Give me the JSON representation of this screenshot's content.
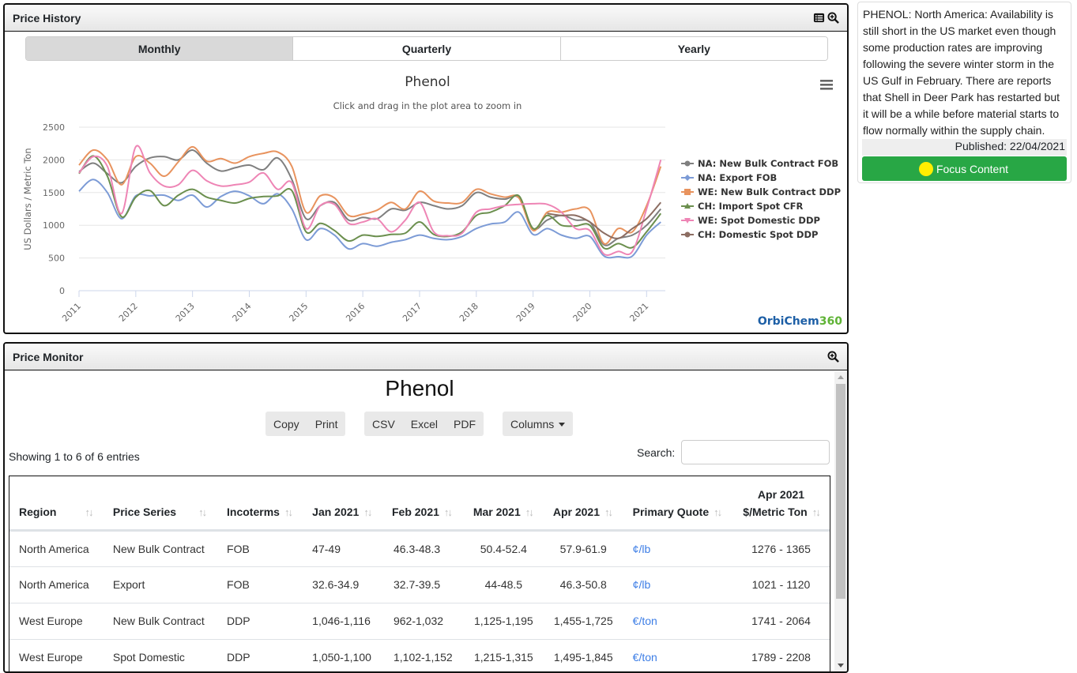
{
  "price_history": {
    "title": "Price History",
    "icons": [
      "table-icon",
      "zoom-in-icon"
    ],
    "tabs": [
      {
        "label": "Monthly",
        "active": true
      },
      {
        "label": "Quarterly",
        "active": false
      },
      {
        "label": "Yearly",
        "active": false
      }
    ],
    "menu_icon": "hamburger-menu-icon",
    "brand": {
      "main": "OrbiChem",
      "suffix": "360"
    }
  },
  "chart_data": {
    "type": "line",
    "title": "Phenol",
    "subtitle": "Click and drag in the plot area to zoom in",
    "xlabel": "",
    "ylabel": "US Dollars / Metric Ton",
    "ylim": [
      0,
      2500
    ],
    "yticks": [
      0,
      500,
      1000,
      1500,
      2000,
      2500
    ],
    "xlim": [
      2011.0,
      2021.33
    ],
    "xticks": [
      "2011",
      "2012",
      "2013",
      "2014",
      "2015",
      "2016",
      "2017",
      "2018",
      "2019",
      "2020",
      "2021"
    ],
    "grid": true,
    "legend_position": "right",
    "x": [
      2011.0,
      2011.25,
      2011.5,
      2011.75,
      2012.0,
      2012.25,
      2012.5,
      2012.75,
      2013.0,
      2013.25,
      2013.5,
      2013.75,
      2014.0,
      2014.25,
      2014.5,
      2014.75,
      2015.0,
      2015.25,
      2015.5,
      2015.75,
      2016.0,
      2016.25,
      2016.5,
      2016.75,
      2017.0,
      2017.25,
      2017.5,
      2017.75,
      2018.0,
      2018.25,
      2018.5,
      2018.75,
      2019.0,
      2019.25,
      2019.5,
      2019.75,
      2020.0,
      2020.25,
      2020.5,
      2020.75,
      2021.0,
      2021.25
    ],
    "series": [
      {
        "name": "NA: New Bulk Contract FOB",
        "color": "#7f7f7f",
        "marker": "circle",
        "values": [
          1820,
          1950,
          1790,
          1650,
          1900,
          2030,
          2050,
          2000,
          2150,
          1950,
          1830,
          1880,
          1920,
          1850,
          2030,
          1700,
          1100,
          1300,
          1350,
          1080,
          1120,
          1100,
          1250,
          1230,
          1350,
          1300,
          1250,
          1300,
          1500,
          1430,
          1400,
          1420,
          950,
          1080,
          1150,
          1080,
          1050,
          700,
          800,
          850,
          1000,
          1250
        ]
      },
      {
        "name": "NA: Export FOB",
        "color": "#7c9bd6",
        "marker": "diamond",
        "values": [
          1520,
          1700,
          1500,
          1100,
          1450,
          1450,
          1460,
          1380,
          1460,
          1280,
          1440,
          1520,
          1450,
          1330,
          1480,
          1250,
          780,
          950,
          850,
          640,
          720,
          680,
          740,
          780,
          850,
          800,
          780,
          830,
          950,
          1020,
          1050,
          1200,
          860,
          950,
          850,
          800,
          830,
          530,
          520,
          530,
          850,
          1050
        ]
      },
      {
        "name": "WE: New Bulk Contract DDP",
        "color": "#e8935e",
        "marker": "square",
        "values": [
          1920,
          2150,
          2000,
          1620,
          2050,
          1950,
          1750,
          1970,
          2200,
          1980,
          2020,
          1950,
          2050,
          2100,
          2120,
          1900,
          1200,
          1450,
          1420,
          1150,
          1170,
          1230,
          1350,
          1250,
          1520,
          1370,
          1340,
          1350,
          1550,
          1480,
          1430,
          1420,
          920,
          1200,
          1200,
          1250,
          1230,
          720,
          950,
          900,
          1300,
          1900
        ]
      },
      {
        "name": "CH: Import Spot CFR",
        "color": "#6b8f4e",
        "marker": "triangle",
        "values": [
          1790,
          2060,
          1750,
          1130,
          1430,
          1530,
          1300,
          1460,
          1550,
          1430,
          1380,
          1340,
          1410,
          1440,
          1450,
          1530,
          900,
          1030,
          920,
          760,
          850,
          830,
          860,
          880,
          1050,
          860,
          830,
          900,
          1150,
          1200,
          1300,
          1450,
          950,
          1150,
          1000,
          990,
          1000,
          650,
          720,
          660,
          900,
          1180
        ]
      },
      {
        "name": "WE: Spot Domestic DDP",
        "color": "#ee85b5",
        "marker": "triangle-down",
        "values": [
          1800,
          2050,
          1900,
          1180,
          2200,
          1800,
          1600,
          1620,
          1840,
          1680,
          1600,
          1620,
          1660,
          1800,
          1550,
          1650,
          950,
          1300,
          1320,
          1030,
          1050,
          1100,
          900,
          1080,
          1350,
          900,
          840,
          880,
          1200,
          1250,
          1300,
          1320,
          1330,
          1320,
          1200,
          950,
          920,
          560,
          600,
          600,
          1250,
          2000
        ]
      },
      {
        "name": "CH: Domestic Spot DDP",
        "color": "#8c6d62",
        "marker": "circle",
        "values": [
          null,
          null,
          null,
          null,
          null,
          null,
          null,
          null,
          null,
          null,
          null,
          null,
          null,
          null,
          null,
          null,
          null,
          null,
          null,
          null,
          null,
          null,
          null,
          null,
          null,
          null,
          null,
          null,
          null,
          null,
          null,
          null,
          null,
          1180,
          1150,
          1150,
          1050,
          880,
          800,
          950,
          1100,
          1350
        ]
      }
    ]
  },
  "news": {
    "text": "PHENOL: North America: Availability is still short in the US market even though some production rates are improving following the severe winter storm in the US Gulf in February. There are reports that Shell in Deer Park has restarted but it will be a while before material starts to flow normally within the supply chain.",
    "published": "Published: 22/04/2021",
    "focus_button": "Focus Content",
    "focus_icon": "sun-icon"
  },
  "price_monitor": {
    "title": "Price Monitor",
    "product": "Phenol",
    "buttons_group1": [
      "Copy",
      "Print"
    ],
    "buttons_group2": [
      "CSV",
      "Excel",
      "PDF"
    ],
    "columns_button": "Columns",
    "info": "Showing 1 to 6 of 6 entries",
    "search_label": "Search:",
    "search_value": "",
    "table": {
      "headers": [
        "Region",
        "Price Series",
        "Incoterms",
        "Jan 2021",
        "Feb 2021",
        "Mar 2021",
        "Apr 2021",
        "Primary Quote",
        "Apr 2021",
        "$/Metric Ton"
      ],
      "rows": [
        [
          "North America",
          "New Bulk Contract",
          "FOB",
          "47-49",
          "46.3-48.3",
          "50.4-52.4",
          "57.9-61.9",
          "¢/lb",
          "1276 - 1365"
        ],
        [
          "North America",
          "Export",
          "FOB",
          "32.6-34.9",
          "32.7-39.5",
          "44-48.5",
          "46.3-50.8",
          "¢/lb",
          "1021 - 1120"
        ],
        [
          "West Europe",
          "New Bulk Contract",
          "DDP",
          "1,046-1,116",
          "962-1,032",
          "1,125-1,195",
          "1,455-1,725",
          "€/ton",
          "1741 - 2064"
        ],
        [
          "West Europe",
          "Spot Domestic",
          "DDP",
          "1,050-1,100",
          "1,102-1,152",
          "1,215-1,315",
          "1,495-1,845",
          "€/ton",
          "1789 - 2208"
        ]
      ]
    }
  }
}
